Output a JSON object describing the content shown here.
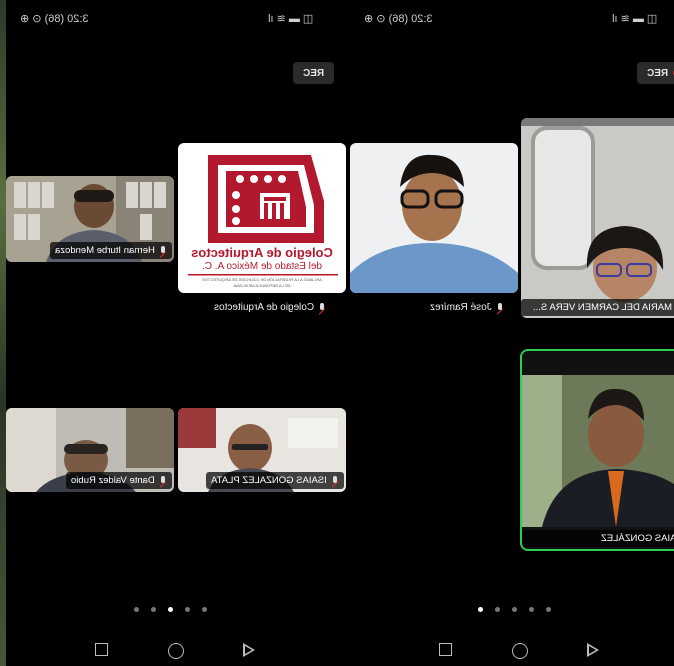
{
  "left_phone": {
    "status": {
      "time": "3:20",
      "badge": "(86)"
    },
    "rec_label": "REC",
    "tiles": [
      {
        "name": "Hernan Iturbe Mendoza"
      },
      {
        "name": "Colegio de Arquitectos"
      },
      {
        "name": "Dante Valdez Rubio"
      },
      {
        "name": "ISAIAS GONZALEZ PLATA"
      }
    ],
    "logo": {
      "line1": "Colegio de Arquitectos",
      "line2": "del Estado de México A. C.",
      "line3": "AFILIADO A LA FEDERACIÓN DE COLEGIOS DE ARQUITECTOS",
      "line4": "DE LA REPÚBLICA MEXICANA",
      "color": "#b3192e"
    },
    "page_dots": {
      "count": 5,
      "active": 2
    }
  },
  "right_phone": {
    "status": {
      "time": "3:20",
      "badge": "(86)"
    },
    "rec_label": "REC",
    "tiles": [
      {
        "name": "José Ramírez"
      },
      {
        "name": "MARIA DEL CARMEN VERA S..."
      },
      {
        "name": "ISAIAS GONZÁLEZ"
      }
    ],
    "page_dots": {
      "count": 5,
      "active": 0
    }
  },
  "colors": {
    "active_speaker": "#2ecc55",
    "rec_dot": "#e0232b"
  },
  "icons": [
    "mic-muted-icon",
    "wifi-icon",
    "battery-icon",
    "nav-recent-icon",
    "nav-home-icon",
    "nav-back-icon"
  ]
}
